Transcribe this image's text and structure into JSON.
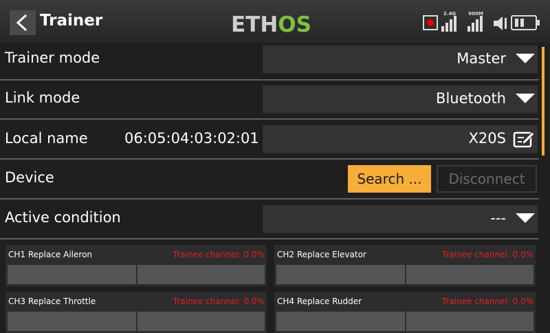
{
  "header": {
    "title": "Trainer",
    "logo_part1": "ETH",
    "logo_part2": "OS",
    "signal_1_label": "2.4G",
    "signal_2_label": "900M"
  },
  "rows": {
    "trainer_mode": {
      "label": "Trainer mode",
      "value": "Master"
    },
    "link_mode": {
      "label": "Link mode",
      "value": "Bluetooth"
    },
    "local_name": {
      "label": "Local name",
      "address": "06:05:04:03:02:01",
      "value": "X20S"
    },
    "device": {
      "label": "Device",
      "search_label": "Search ...",
      "disconnect_label": "Disconnect"
    },
    "active_condition": {
      "label": "Active condition",
      "value": "---"
    }
  },
  "channels": [
    {
      "title": "CH1 Replace Aileron",
      "trainee": "Trainee channel: 0.0%"
    },
    {
      "title": "CH2 Replace Elevator",
      "trainee": "Trainee channel: 0.0%"
    },
    {
      "title": "CH3 Replace Throttle",
      "trainee": "Trainee channel: 0.0%"
    },
    {
      "title": "CH4 Replace Rudder",
      "trainee": "Trainee channel: 0.0%"
    }
  ],
  "colors": {
    "accent": "#f7ad3a",
    "logo_green": "#7fc042",
    "warning_red": "#e32020"
  }
}
